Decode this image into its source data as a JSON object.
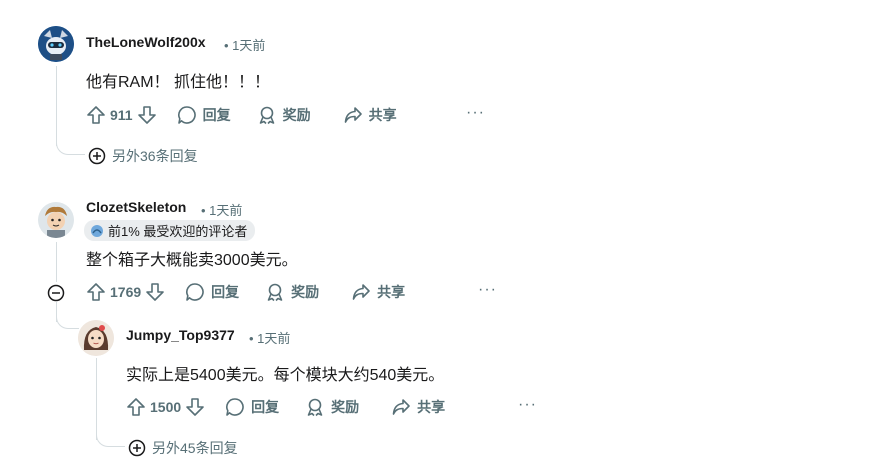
{
  "comments": [
    {
      "username": "TheLoneWolf200x",
      "time": "• 1天前",
      "body": "他有RAM！ 抓住他！！！",
      "votes": "911",
      "reply_label": "回复",
      "award_label": "奖励",
      "share_label": "共享",
      "more_replies": "另外36条回复"
    },
    {
      "username": "ClozetSkeleton",
      "time": "• 1天前",
      "flair": "前1% 最受欢迎的评论者",
      "body": "整个箱子大概能卖3000美元。",
      "votes": "1769",
      "reply_label": "回复",
      "award_label": "奖励",
      "share_label": "共享"
    },
    {
      "username": "Jumpy_Top9377",
      "time": "• 1天前",
      "body": "实际上是5400美元。每个模块大约540美元。",
      "votes": "1500",
      "reply_label": "回复",
      "award_label": "奖励",
      "share_label": "共享",
      "more_replies": "另外45条回复"
    }
  ],
  "overflow_glyph": "···",
  "colors": {
    "meta": "#576f76",
    "line": "#d6dde0",
    "flair_bg": "#eaedef"
  }
}
